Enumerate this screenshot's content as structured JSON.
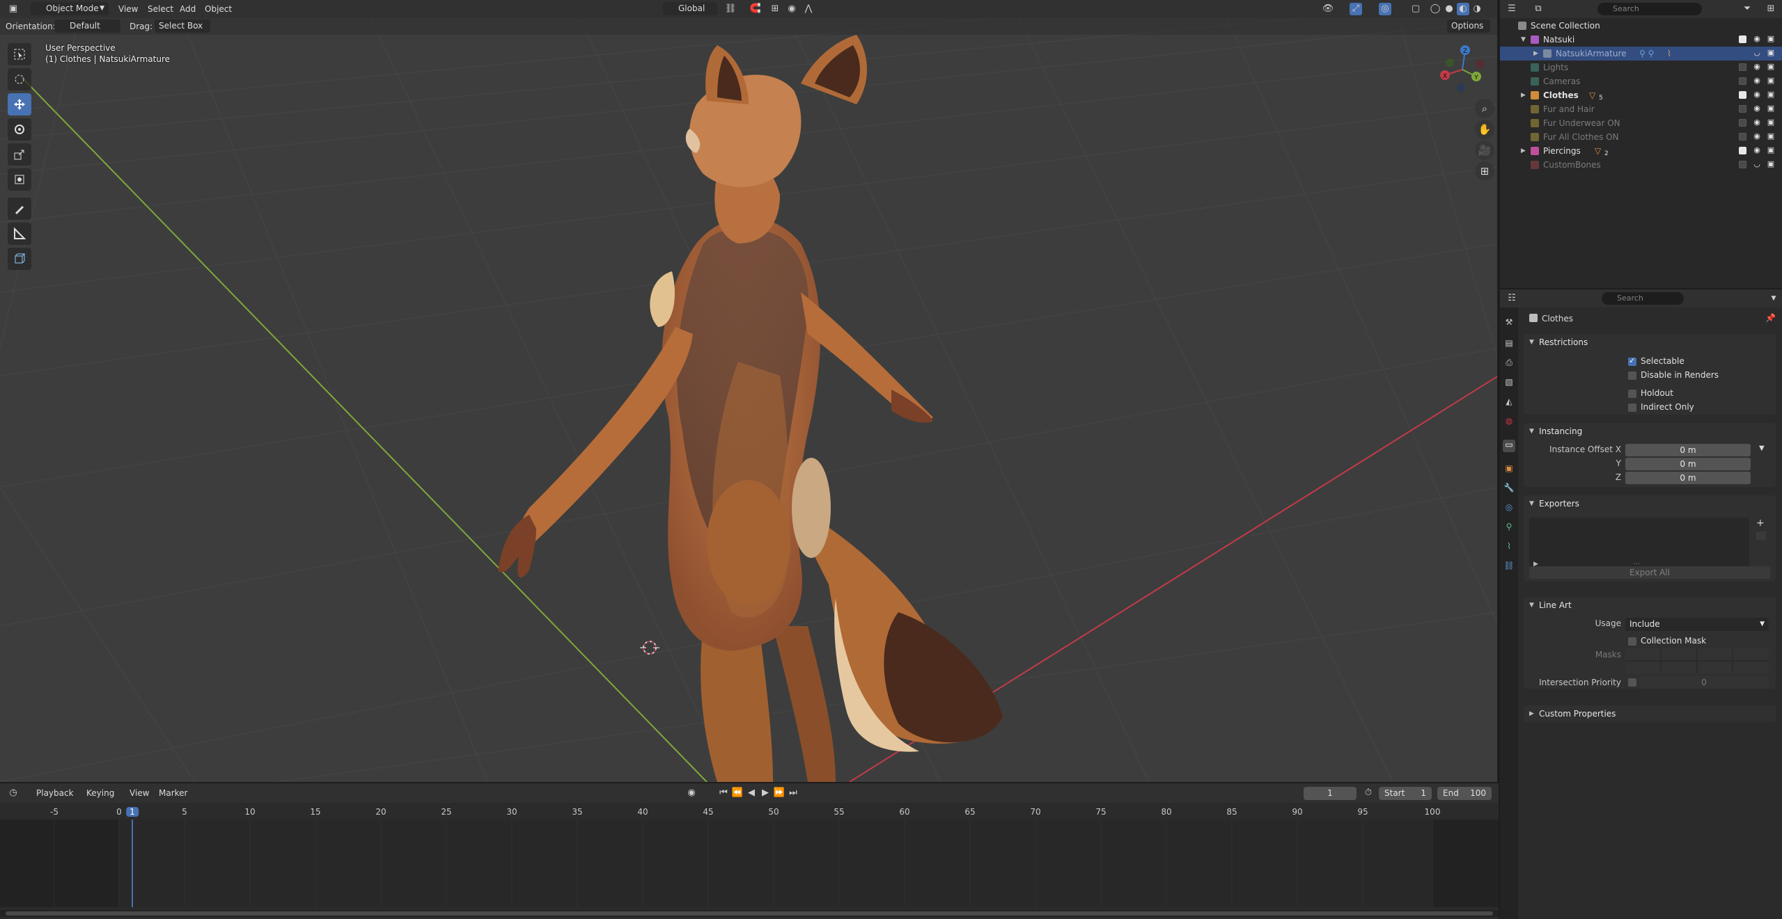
{
  "viewport": {
    "editor_icon": "cube-icon",
    "mode": "Object Mode",
    "menus": [
      "View",
      "Select",
      "Add",
      "Object"
    ],
    "transform_orientation": "Global",
    "orientation_label": "Orientation:",
    "orientation_value": "Default",
    "drag_label": "Drag:",
    "drag_value": "Select Box",
    "options_label": "Options",
    "perspective_text": "User Perspective",
    "context_text": "(1) Clothes | NatsukiArmature",
    "gizmo_axes": [
      "X",
      "Y",
      "Z"
    ],
    "colors": {
      "background": "#3d3d3d",
      "x_axis": "#c23b48",
      "y_axis": "#7fa83a",
      "z_axis": "#3d79c8",
      "active_tool": "#4772b3"
    }
  },
  "timeline": {
    "menus": [
      "Playback",
      "Keying",
      "View",
      "Marker"
    ],
    "current_frame": "1",
    "start_label": "Start",
    "start_value": "1",
    "end_label": "End",
    "end_value": "100",
    "ruler": [
      "-5",
      "0",
      "1",
      "5",
      "10",
      "15",
      "20",
      "25",
      "30",
      "35",
      "40",
      "45",
      "50",
      "55",
      "60",
      "65",
      "70",
      "75",
      "80",
      "85",
      "90",
      "95",
      "100"
    ]
  },
  "outliner": {
    "search_placeholder": "Search",
    "rows": [
      {
        "label": "Scene Collection",
        "indent": 0,
        "icon": "scene-collection-icon",
        "state": "normal"
      },
      {
        "label": "Natsuki",
        "indent": 1,
        "icon": "collection-icon",
        "icon_color": "#a85bc0",
        "state": "normal",
        "checked": true
      },
      {
        "label": "NatsukiArmature",
        "indent": 2,
        "icon": "armature-icon",
        "state": "selected",
        "checked": true
      },
      {
        "label": "Lights",
        "indent": 1,
        "icon": "collection-icon",
        "icon_color": "#4a9b8b",
        "state": "dim",
        "checked": false
      },
      {
        "label": "Cameras",
        "indent": 1,
        "icon": "collection-icon",
        "icon_color": "#4a9b8b",
        "state": "dim",
        "checked": false
      },
      {
        "label": "Clothes",
        "indent": 1,
        "icon": "collection-icon",
        "icon_color": "#d18b3a",
        "state": "bold",
        "checked": true,
        "badge": "5"
      },
      {
        "label": "Fur and Hair",
        "indent": 1,
        "icon": "collection-icon",
        "icon_color": "#b9a33a",
        "state": "dim",
        "checked": false
      },
      {
        "label": "Fur Underwear ON",
        "indent": 1,
        "icon": "collection-icon",
        "icon_color": "#b9a33a",
        "state": "dim",
        "checked": false
      },
      {
        "label": "Fur All Clothes ON",
        "indent": 1,
        "icon": "collection-icon",
        "icon_color": "#b9a33a",
        "state": "dim",
        "checked": false
      },
      {
        "label": "Piercings",
        "indent": 1,
        "icon": "collection-icon",
        "icon_color": "#c24f9b",
        "state": "normal",
        "checked": true,
        "badge": "2"
      },
      {
        "label": "CustomBones",
        "indent": 1,
        "icon": "collection-icon",
        "icon_color": "#a34a4a",
        "state": "dim",
        "checked": false
      }
    ]
  },
  "properties": {
    "search_placeholder": "Search",
    "context_title": "Clothes",
    "restrictions": {
      "title": "Restrictions",
      "selectable": "Selectable",
      "disable_in_renders": "Disable in Renders",
      "holdout": "Holdout",
      "indirect_only": "Indirect Only"
    },
    "instancing": {
      "title": "Instancing",
      "offset_x_label": "Instance Offset X",
      "y_label": "Y",
      "z_label": "Z",
      "offset_x": "0 m",
      "offset_y": "0 m",
      "offset_z": "0 m"
    },
    "exporters": {
      "title": "Exporters",
      "export_all": "Export All"
    },
    "line_art": {
      "title": "Line Art",
      "usage_label": "Usage",
      "usage_value": "Include",
      "collection_mask": "Collection Mask",
      "masks_label": "Masks",
      "intersection_priority_label": "Intersection Priority",
      "intersection_priority": "0"
    },
    "custom_properties": {
      "title": "Custom Properties"
    }
  }
}
